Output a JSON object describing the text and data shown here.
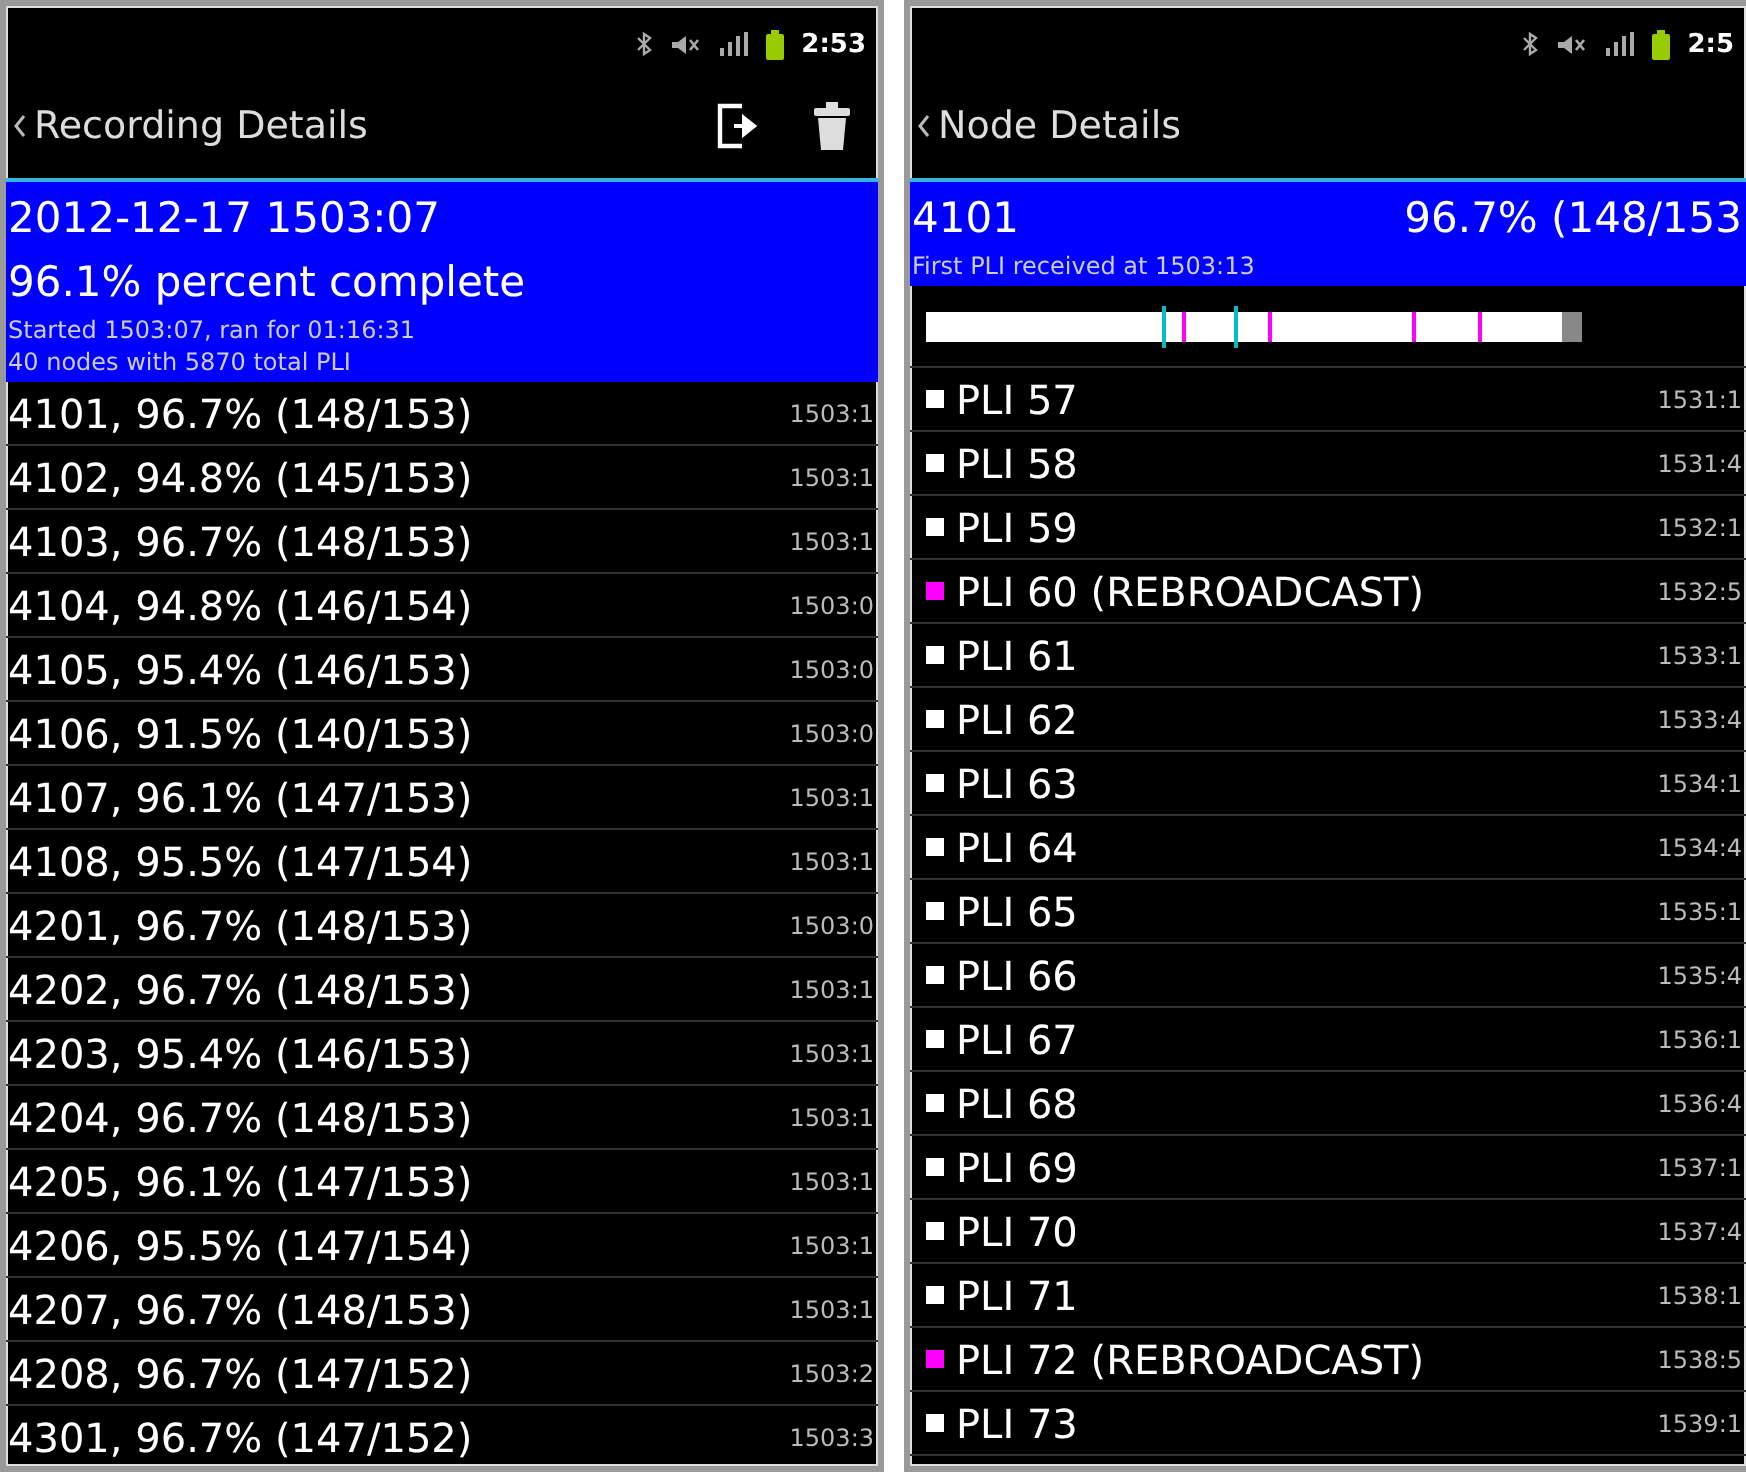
{
  "left": {
    "status_time": "2:53",
    "title": "Recording Details",
    "header": {
      "date": "2012-12-17 1503:07",
      "percent": "96.1% percent complete",
      "started": "Started 1503:07, ran for 01:16:31",
      "summary": "40 nodes with 5870 total PLI"
    },
    "rows": [
      {
        "label": "4101, 96.7% (148/153)",
        "time": "1503:1"
      },
      {
        "label": "4102, 94.8% (145/153)",
        "time": "1503:1"
      },
      {
        "label": "4103, 96.7% (148/153)",
        "time": "1503:1"
      },
      {
        "label": "4104, 94.8% (146/154)",
        "time": "1503:0"
      },
      {
        "label": "4105, 95.4% (146/153)",
        "time": "1503:0"
      },
      {
        "label": "4106, 91.5% (140/153)",
        "time": "1503:0"
      },
      {
        "label": "4107, 96.1% (147/153)",
        "time": "1503:1"
      },
      {
        "label": "4108, 95.5% (147/154)",
        "time": "1503:1"
      },
      {
        "label": "4201, 96.7% (148/153)",
        "time": "1503:0"
      },
      {
        "label": "4202, 96.7% (148/153)",
        "time": "1503:1"
      },
      {
        "label": "4203, 95.4% (146/153)",
        "time": "1503:1"
      },
      {
        "label": "4204, 96.7% (148/153)",
        "time": "1503:1"
      },
      {
        "label": "4205, 96.1% (147/153)",
        "time": "1503:1"
      },
      {
        "label": "4206, 95.5% (147/154)",
        "time": "1503:1"
      },
      {
        "label": "4207, 96.7% (148/153)",
        "time": "1503:1"
      },
      {
        "label": "4208, 96.7% (147/152)",
        "time": "1503:2"
      },
      {
        "label": "4301, 96.7% (147/152)",
        "time": "1503:3"
      }
    ]
  },
  "right": {
    "status_time": "2:5",
    "title": "Node Details",
    "header": {
      "node": "4101",
      "percent": "96.7% (148/153",
      "first": "First PLI received at 1503:13"
    },
    "progress": {
      "level": 0.97
    },
    "rows": [
      {
        "label": "PLI 57",
        "time": "1531:1",
        "color": "#ffffff"
      },
      {
        "label": "PLI 58",
        "time": "1531:4",
        "color": "#ffffff"
      },
      {
        "label": "PLI 59",
        "time": "1532:1",
        "color": "#ffffff"
      },
      {
        "label": "PLI 60 (REBROADCAST)",
        "time": "1532:5",
        "color": "#ff00ff"
      },
      {
        "label": "PLI 61",
        "time": "1533:1",
        "color": "#ffffff"
      },
      {
        "label": "PLI 62",
        "time": "1533:4",
        "color": "#ffffff"
      },
      {
        "label": "PLI 63",
        "time": "1534:1",
        "color": "#ffffff"
      },
      {
        "label": "PLI 64",
        "time": "1534:4",
        "color": "#ffffff"
      },
      {
        "label": "PLI 65",
        "time": "1535:1",
        "color": "#ffffff"
      },
      {
        "label": "PLI 66",
        "time": "1535:4",
        "color": "#ffffff"
      },
      {
        "label": "PLI 67",
        "time": "1536:1",
        "color": "#ffffff"
      },
      {
        "label": "PLI 68",
        "time": "1536:4",
        "color": "#ffffff"
      },
      {
        "label": "PLI 69",
        "time": "1537:1",
        "color": "#ffffff"
      },
      {
        "label": "PLI 70",
        "time": "1537:4",
        "color": "#ffffff"
      },
      {
        "label": "PLI 71",
        "time": "1538:1",
        "color": "#ffffff"
      },
      {
        "label": "PLI 72 (REBROADCAST)",
        "time": "1538:5",
        "color": "#ff00ff"
      },
      {
        "label": "PLI 73",
        "time": "1539:1",
        "color": "#ffffff"
      }
    ]
  }
}
